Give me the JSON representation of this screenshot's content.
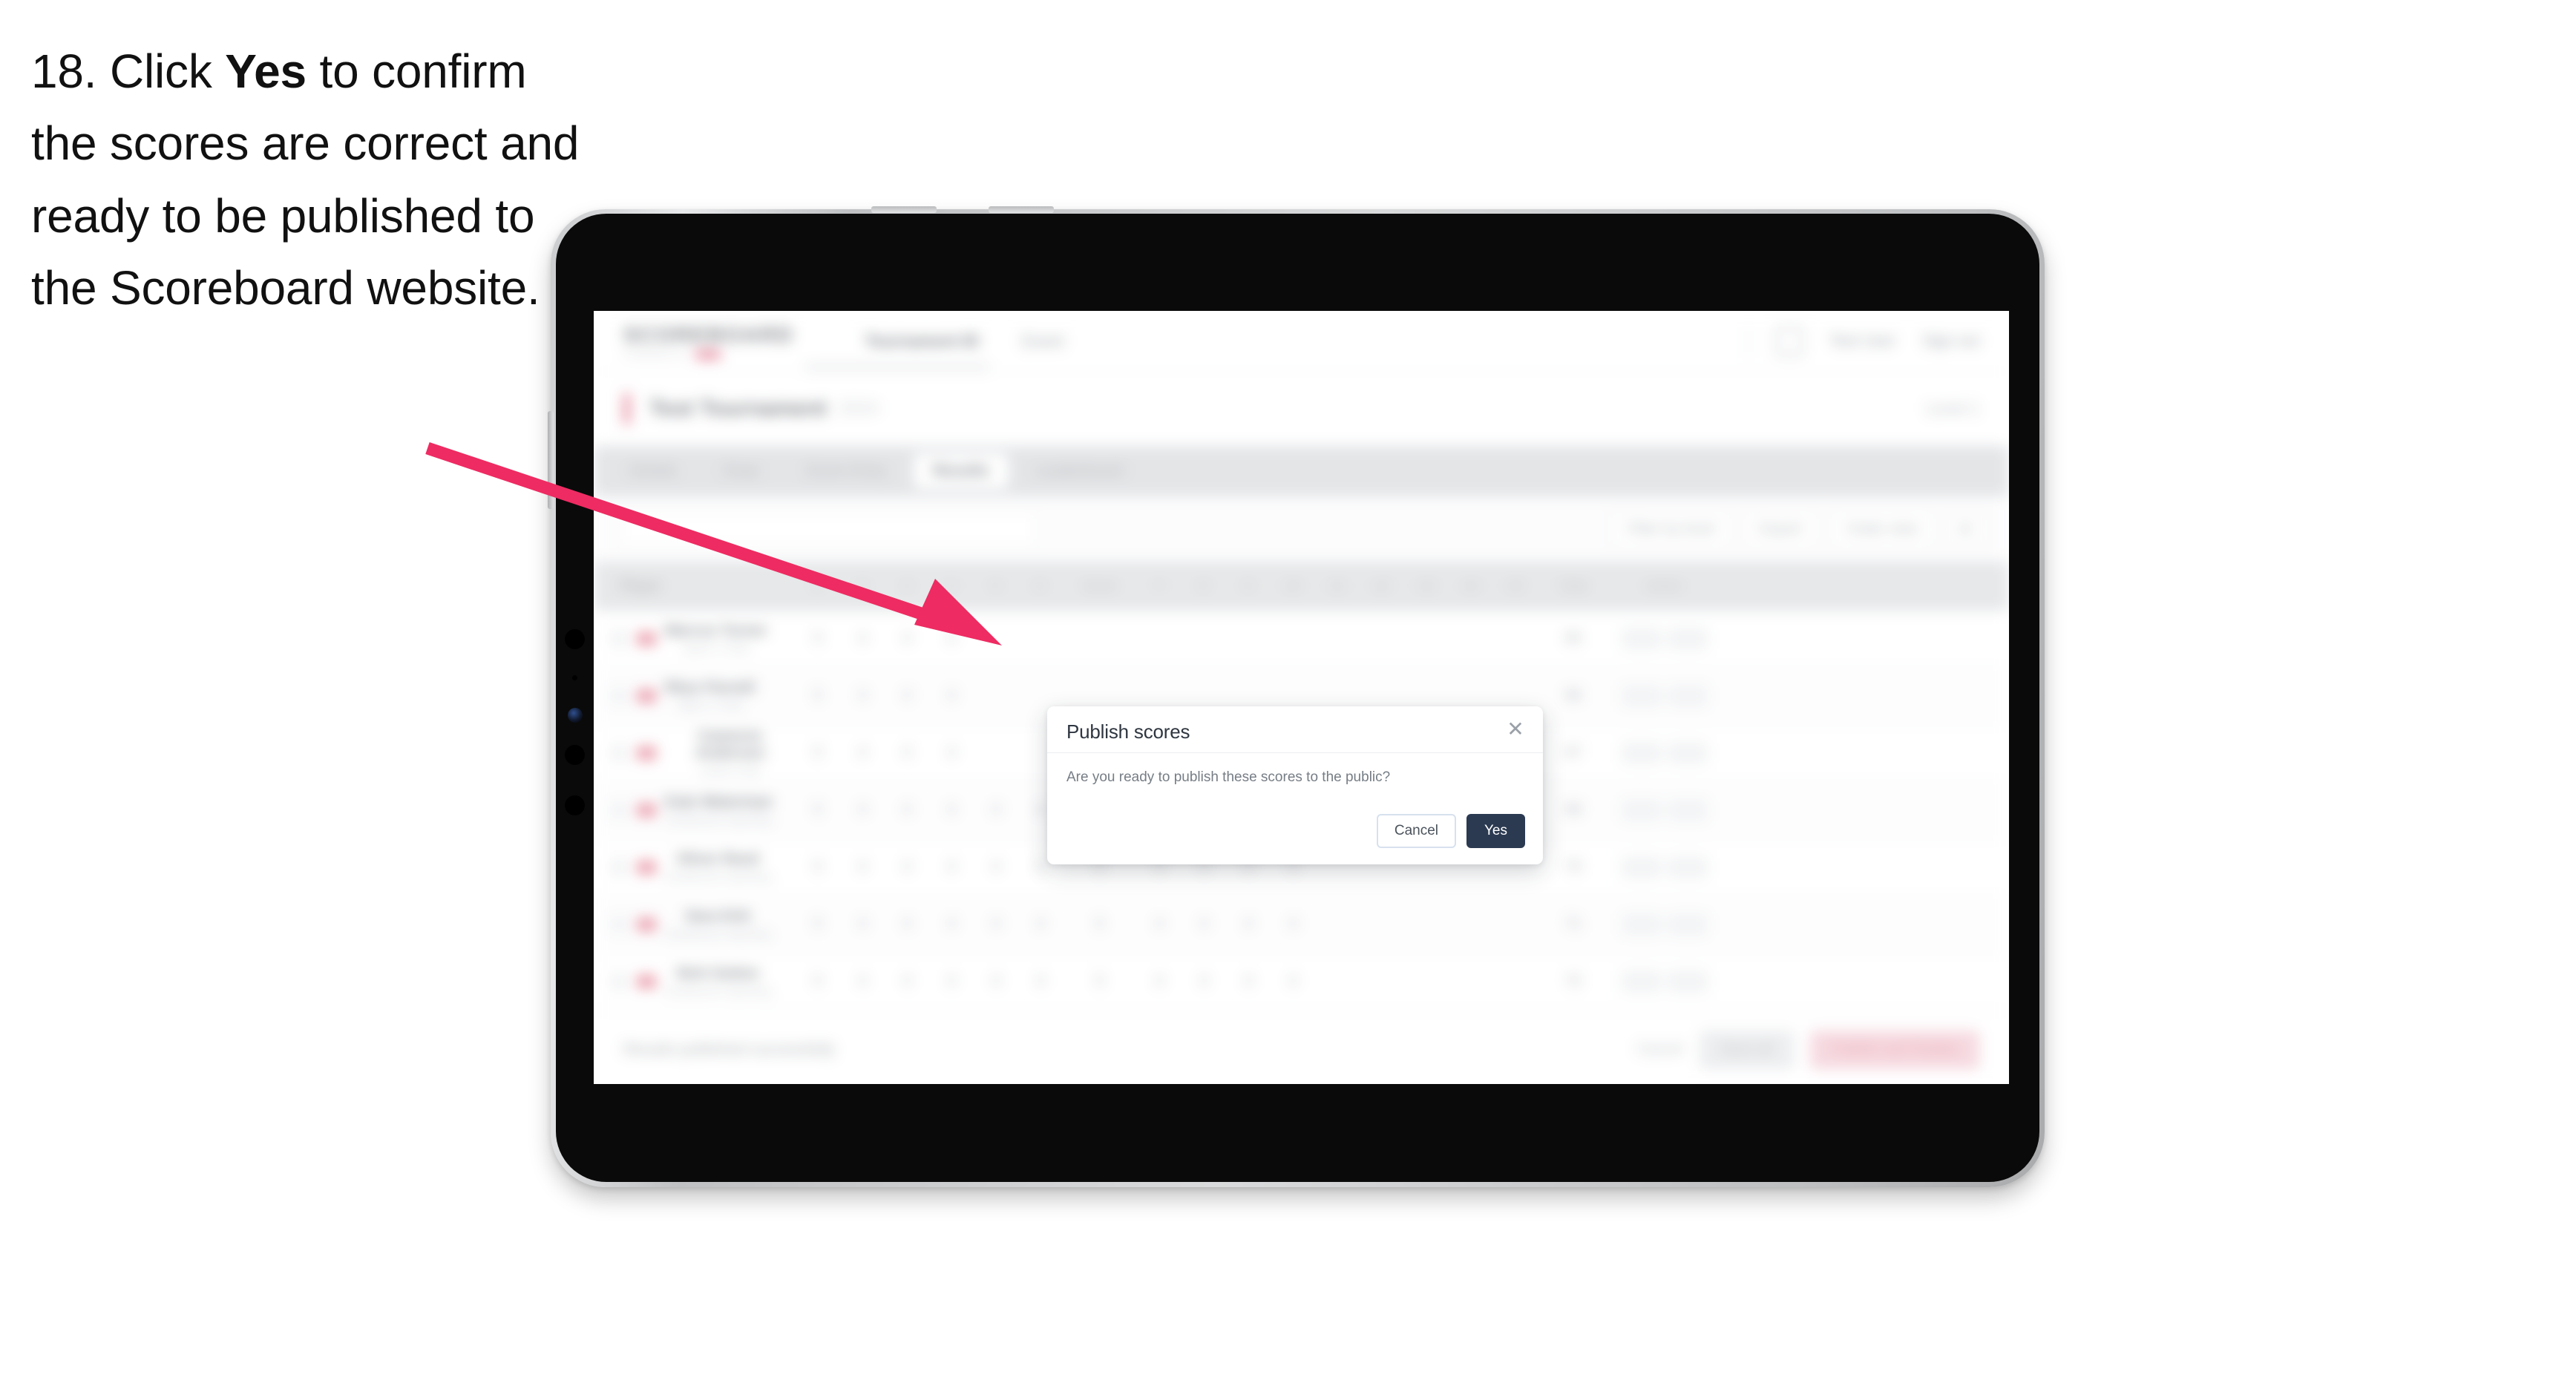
{
  "caption": {
    "step_number": "18.",
    "text_before": " Click ",
    "emphasis": "Yes",
    "text_after": " to confirm the scores are correct and ready to be published to the Scoreboard website."
  },
  "colors": {
    "arrow": "#EE2B62",
    "accent_pink": "#F2496F",
    "primary_dark": "#2B3A51",
    "device_frame": "#C9CBCD",
    "bezel": "#0A0A0A"
  },
  "device": {
    "type": "tablet",
    "orientation": "landscape"
  },
  "app": {
    "header": {
      "brand_word": "SCOREBOARD",
      "brand_sub": "POWERED BY",
      "nav": [
        {
          "label": "Tournament ID"
        },
        {
          "label": "Event"
        }
      ],
      "right": [
        {
          "label": "Test User"
        },
        {
          "label": "Sign out"
        }
      ]
    },
    "event": {
      "name": "Test Tournament",
      "sub": "2024",
      "right_label": "Level 1"
    },
    "tabs": [
      {
        "label": "Details",
        "active": false
      },
      {
        "label": "Draw",
        "active": false
      },
      {
        "label": "Score Entry",
        "active": false
      },
      {
        "label": "Results",
        "active": true
      },
      {
        "label": "Leaderboard",
        "active": false
      }
    ],
    "toolbar": {
      "search_placeholder": "Search",
      "buttons": [
        {
          "label": "Filter by level"
        },
        {
          "label": "Export"
        },
        {
          "label": "Order view"
        },
        {
          "label": "☰"
        }
      ]
    },
    "table": {
      "columns_player": "Player",
      "columns_num": [
        "1",
        "2",
        "3",
        "4",
        "5",
        "6",
        "7",
        "8",
        "9",
        "10",
        "11",
        "12",
        "13",
        "14",
        "15"
      ],
      "columns_wide": [
        "Score"
      ],
      "columns_total": "Total",
      "columns_action": "Action",
      "rows": [
        {
          "name": "Marcus Turner",
          "club": "Sport 1 Club",
          "scores": [
            "5",
            "4",
            "4",
            "4",
            "",
            "",
            "",
            "",
            "",
            "",
            "",
            "",
            "",
            "",
            ""
          ],
          "total": "65",
          "rank": "1st"
        },
        {
          "name": "Rhys Parnell",
          "club": "Sport 1 Club",
          "scores": [
            "5",
            "4",
            "4",
            "4",
            "",
            "",
            "",
            "",
            "",
            "",
            "",
            "",
            "",
            "",
            ""
          ],
          "total": "66",
          "rank": "2nd"
        },
        {
          "name": "Cameron Anderson",
          "club": "Active Club",
          "scores": [
            "5",
            "4",
            "4",
            "4",
            "",
            "",
            "",
            "",
            "",
            "",
            "",
            "",
            "",
            "",
            ""
          ],
          "total": "67",
          "rank": "3rd"
        },
        {
          "name": "Kate Waterman",
          "club": "Sunbourne Sporting",
          "scores": [
            "5",
            "4",
            "4",
            "4",
            "4",
            "4",
            "5",
            "4",
            "4",
            "4",
            "4",
            "",
            "",
            "",
            ""
          ],
          "total": "68",
          "rank": "4th"
        },
        {
          "name": "Oliver Reed",
          "club": "Sunbourne Sporting",
          "scores": [
            "5",
            "4",
            "4",
            "4",
            "4",
            "4",
            "5",
            "4",
            "4",
            "4",
            "4",
            "",
            "",
            "",
            ""
          ],
          "total": "70",
          "rank": "5th"
        },
        {
          "name": "Sara Kirk",
          "club": "Sunbourne Sporting",
          "scores": [
            "5",
            "4",
            "4",
            "4",
            "4",
            "4",
            "5",
            "4",
            "4",
            "4",
            "4",
            "",
            "",
            "",
            ""
          ],
          "total": "71",
          "rank": "6th"
        },
        {
          "name": "Nick Sutton",
          "club": "Sunbourne Sporting",
          "scores": [
            "5",
            "4",
            "4",
            "4",
            "4",
            "4",
            "5",
            "4",
            "4",
            "4",
            "4",
            "",
            "",
            "",
            ""
          ],
          "total": "72",
          "rank": "7th"
        }
      ]
    },
    "footer": {
      "note": "Results published successfully",
      "link": "Cancel",
      "button_grey": "Save all",
      "button_pink": "Publish and finalise"
    }
  },
  "modal": {
    "title": "Publish scores",
    "close_icon": "close-icon",
    "body": "Are you ready to publish these scores to the public?",
    "cancel_label": "Cancel",
    "confirm_label": "Yes"
  }
}
